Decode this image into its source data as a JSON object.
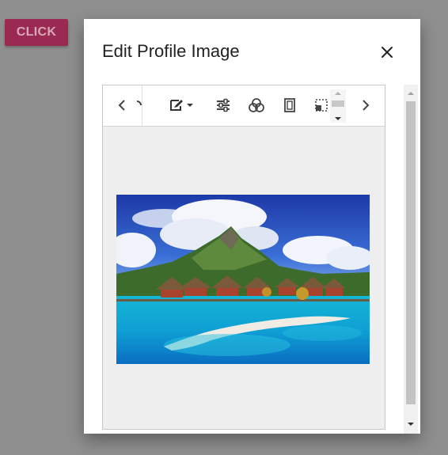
{
  "page": {
    "trigger_button_label": "CLICK"
  },
  "dialog": {
    "title": "Edit Profile Image"
  },
  "toolbar": {
    "tools": [
      "scroll-left-icon",
      "rotate-icon",
      "annotate-icon",
      "adjust-icon",
      "filter-icon",
      "frame-icon",
      "crop-icon",
      "scroll-right-icon"
    ]
  },
  "colors": {
    "accent": "#9b2a52",
    "backdrop": "#8f8f8f",
    "canvas": "#eeeeee"
  }
}
